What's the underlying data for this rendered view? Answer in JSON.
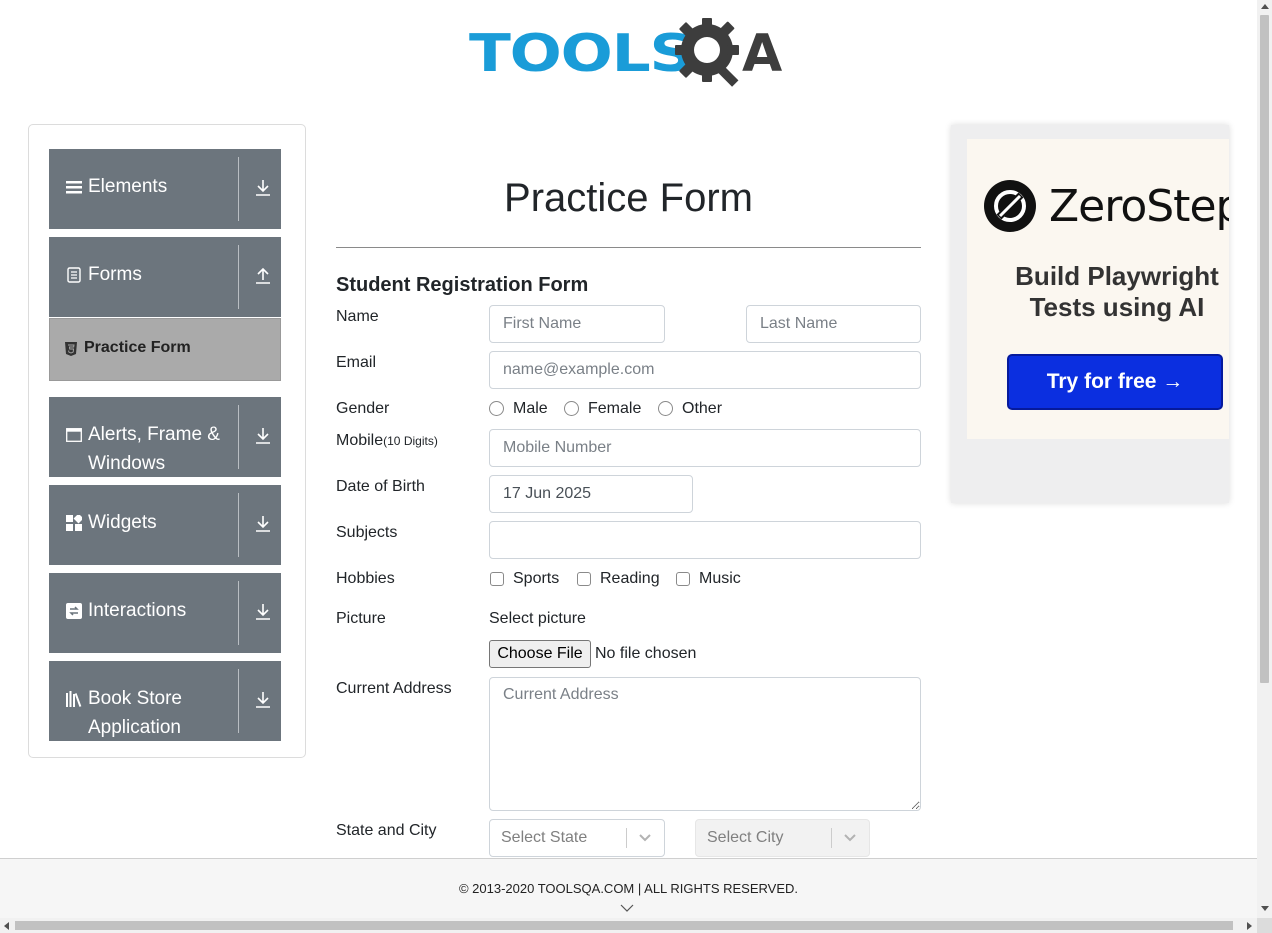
{
  "header": {
    "logo_text": "TOOLS",
    "logo_suffix": "A",
    "logo_colors": {
      "blue": "#1a9cd8",
      "dark": "#3d3d3d"
    }
  },
  "nav": {
    "groups": [
      {
        "label": "Elements",
        "icon": "hamburger-icon",
        "expanded": false
      },
      {
        "label": "Forms",
        "icon": "form-icon",
        "expanded": true
      },
      {
        "label": "Alerts, Frame & Windows",
        "icon": "window-icon",
        "expanded": false
      },
      {
        "label": "Widgets",
        "icon": "widgets-icon",
        "expanded": false
      },
      {
        "label": "Interactions",
        "icon": "interactions-icon",
        "expanded": false
      },
      {
        "label": "Book Store Application",
        "icon": "books-icon",
        "expanded": false
      }
    ],
    "active_item": {
      "label": "Practice Form",
      "icon": "html5-icon"
    }
  },
  "form": {
    "title": "Practice Form",
    "subtitle": "Student Registration Form",
    "name_label": "Name",
    "first_name_placeholder": "First Name",
    "last_name_placeholder": "Last Name",
    "email_label": "Email",
    "email_placeholder": "name@example.com",
    "gender_label": "Gender",
    "gender_options": [
      "Male",
      "Female",
      "Other"
    ],
    "mobile_label": "Mobile",
    "mobile_hint": "(10 Digits)",
    "mobile_placeholder": "Mobile Number",
    "dob_label": "Date of Birth",
    "dob_value": "17 Jun 2025",
    "subjects_label": "Subjects",
    "hobbies_label": "Hobbies",
    "hobby_options": [
      "Sports",
      "Reading",
      "Music"
    ],
    "picture_label": "Picture",
    "picture_prompt": "Select picture",
    "file_button": "Choose File",
    "file_status": "No file chosen",
    "address_label": "Current Address",
    "address_placeholder": "Current Address",
    "state_city_label": "State and City",
    "state_placeholder": "Select State",
    "city_placeholder": "Select City"
  },
  "ad": {
    "brand": "ZeroStep",
    "tagline": "Build Playwright Tests using AI",
    "cta": "Try for free →",
    "cta_color": "#0b2fe0"
  },
  "footer": {
    "copyright": "© 2013-2020 TOOLSQA.COM | ALL RIGHTS RESERVED."
  }
}
